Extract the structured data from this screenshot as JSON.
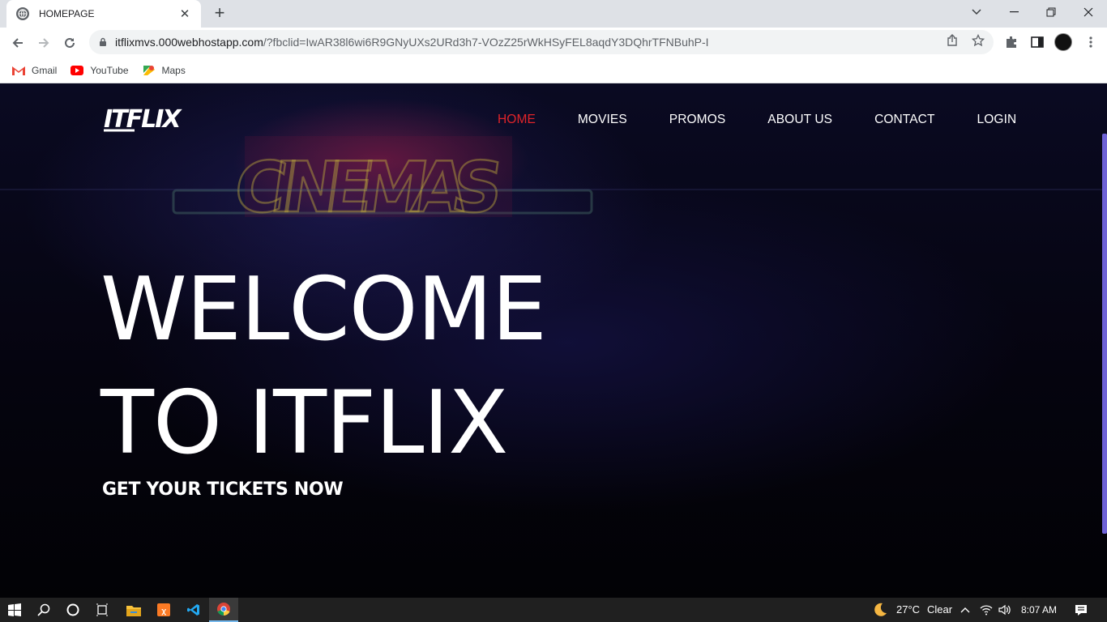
{
  "browser": {
    "tab_title": "HOMEPAGE",
    "url_host": "itflixmvs.000webhostapp.com",
    "url_path": "/?fbclid=IwAR38l6wi6R9GNyUXs2URd3h7-VOzZ25rWkHSyFEL8aqdY3DQhrTFNBuhP-I",
    "bookmarks": [
      {
        "label": "Gmail",
        "icon": "gmail-icon"
      },
      {
        "label": "YouTube",
        "icon": "youtube-icon"
      },
      {
        "label": "Maps",
        "icon": "maps-icon"
      }
    ]
  },
  "site": {
    "logo_text": "ITFLIX",
    "nav": [
      "HOME",
      "MOVIES",
      "PROMOS",
      "ABOUT US",
      "CONTACT",
      "LOGIN"
    ],
    "active_nav": "HOME",
    "background_sign": "CINEMAS",
    "hero_line1": "WELCOME",
    "hero_line2": "TO ITFLIX",
    "hero_subtitle": "GET YOUR TICKETS NOW"
  },
  "taskbar": {
    "weather_temp": "27°C",
    "weather_desc": "Clear",
    "time": "8:07 AM"
  },
  "colors": {
    "active_nav": "#e0242a",
    "scrollbar": "#6e62d6",
    "taskbar": "#202020"
  }
}
